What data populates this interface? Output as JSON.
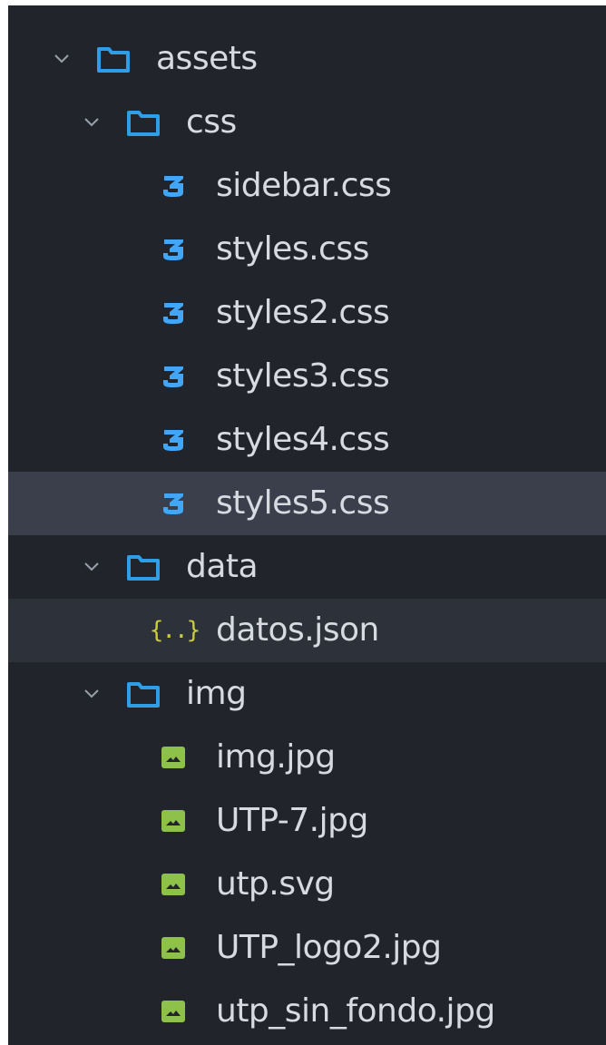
{
  "explorer": {
    "colors": {
      "background": "#21252b",
      "text": "#d7dae0",
      "folder_icon": "#2f9ee6",
      "css_icon": "#42a5f5",
      "json_icon": "#cbcb41",
      "image_icon": "#8dc149",
      "selected_row": "#3a3f4b",
      "hover_row": "#2c313a"
    },
    "tree": [
      {
        "label": "assets",
        "kind": "folder",
        "expanded": true,
        "icon": "folder-icon"
      },
      {
        "label": "css",
        "kind": "folder",
        "expanded": true,
        "icon": "folder-icon"
      },
      {
        "label": "sidebar.css",
        "kind": "file",
        "icon": "css3-icon"
      },
      {
        "label": "styles.css",
        "kind": "file",
        "icon": "css3-icon"
      },
      {
        "label": "styles2.css",
        "kind": "file",
        "icon": "css3-icon"
      },
      {
        "label": "styles3.css",
        "kind": "file",
        "icon": "css3-icon"
      },
      {
        "label": "styles4.css",
        "kind": "file",
        "icon": "css3-icon"
      },
      {
        "label": "styles5.css",
        "kind": "file",
        "icon": "css3-icon",
        "selected": true
      },
      {
        "label": "data",
        "kind": "folder",
        "expanded": true,
        "icon": "folder-icon"
      },
      {
        "label": "datos.json",
        "kind": "file",
        "icon": "json-icon",
        "json_glyph": "{..}"
      },
      {
        "label": "img",
        "kind": "folder",
        "expanded": true,
        "icon": "folder-icon"
      },
      {
        "label": "img.jpg",
        "kind": "file",
        "icon": "image-icon"
      },
      {
        "label": "UTP-7.jpg",
        "kind": "file",
        "icon": "image-icon"
      },
      {
        "label": "utp.svg",
        "kind": "file",
        "icon": "image-icon"
      },
      {
        "label": "UTP_logo2.jpg",
        "kind": "file",
        "icon": "image-icon"
      },
      {
        "label": "utp_sin_fondo.jpg",
        "kind": "file",
        "icon": "image-icon"
      }
    ]
  }
}
